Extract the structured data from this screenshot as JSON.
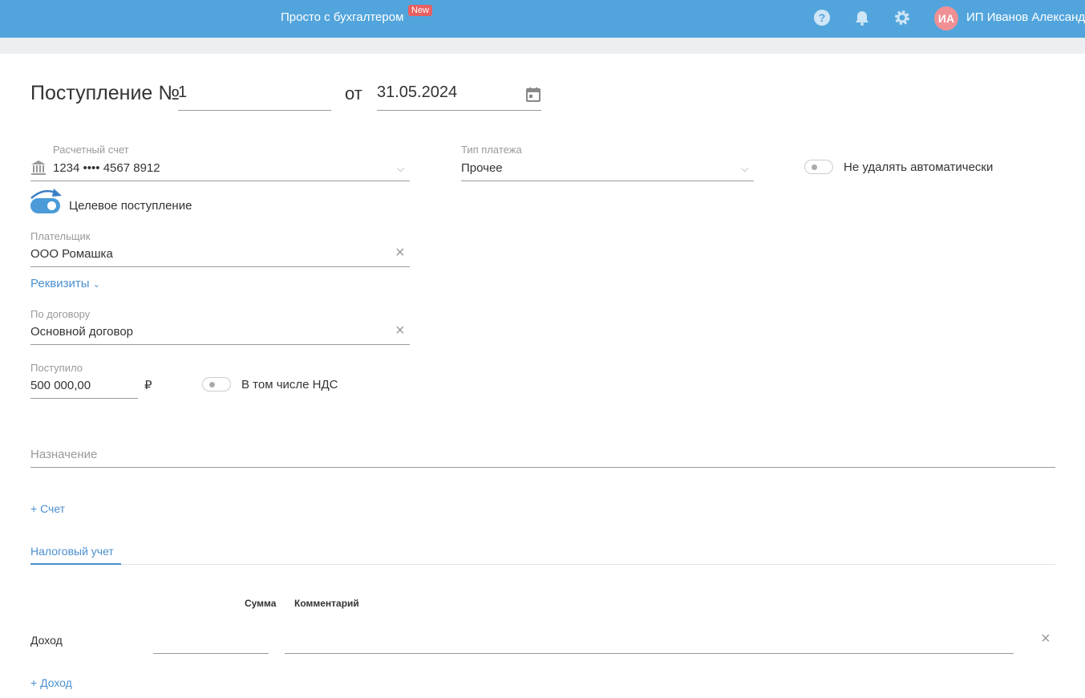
{
  "header": {
    "brand": "Просто с бухгалтером",
    "badge": "New",
    "avatar_initials": "ИА",
    "user_name": "ИП Иванов Александ"
  },
  "doc": {
    "title": "Поступление №",
    "number": "1",
    "date_prefix": "от",
    "date": "31.05.2024"
  },
  "account": {
    "label": "Расчетный счет",
    "value": "1234 •••• 4567 8912"
  },
  "payment_type": {
    "label": "Тип платежа",
    "value": "Прочее"
  },
  "no_delete": {
    "label": "Не удалять автоматически",
    "on": false
  },
  "targeted": {
    "label": "Целевое поступление",
    "on": true
  },
  "payer": {
    "label": "Плательщик",
    "value": "ООО Ромашка"
  },
  "requisites_link": "Реквизиты",
  "contract": {
    "label": "По договору",
    "value": "Основной договор"
  },
  "amount": {
    "label": "Поступило",
    "value": "500 000,00",
    "currency": "₽"
  },
  "vat": {
    "label": "В том числе НДС",
    "on": false
  },
  "purpose": {
    "placeholder": "Назначение"
  },
  "add_invoice": "+ Счет",
  "tab": "Налоговый учет",
  "table": {
    "col_sum": "Сумма",
    "col_comment": "Комментарий",
    "row_label": "Доход",
    "sum": "",
    "comment": ""
  },
  "add_income": "+ Доход"
}
